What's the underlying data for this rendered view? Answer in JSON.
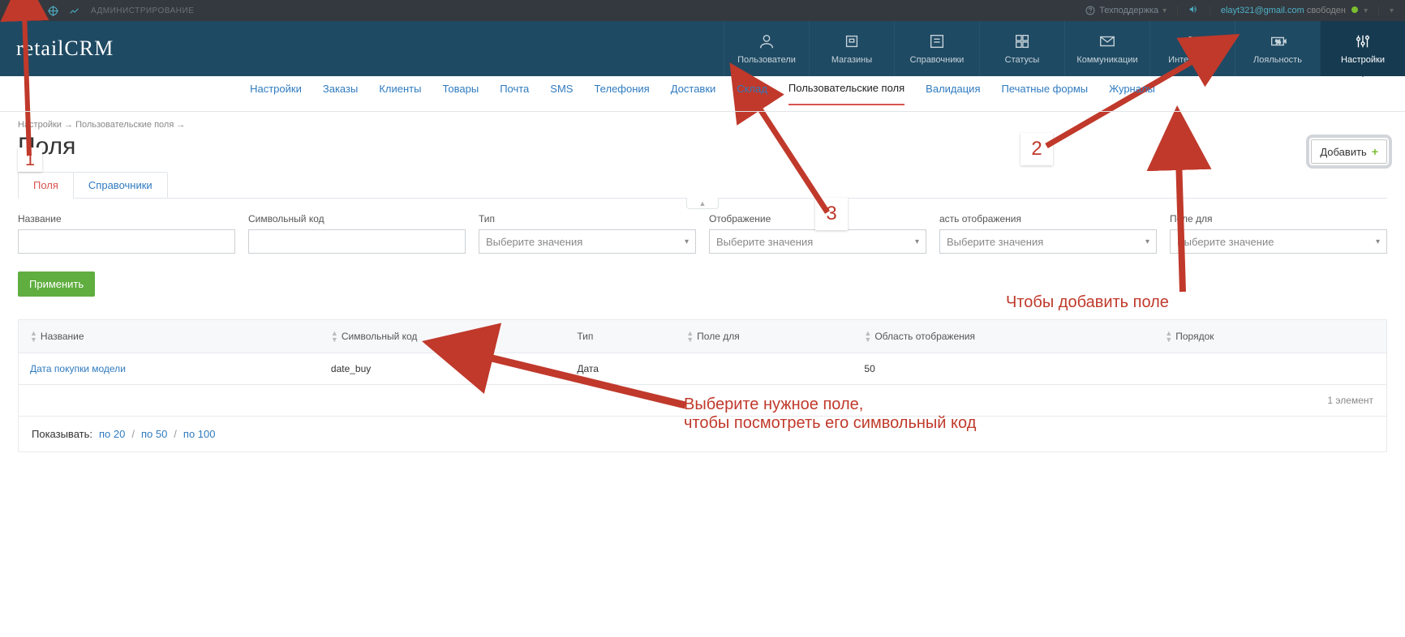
{
  "topbar": {
    "admin_label": "АДМИНИСТРИРОВАНИЕ",
    "support_label": "Техподдержка",
    "user_email": "elayt321@gmail.com",
    "user_status": "свободен"
  },
  "logo_text": "retailCRM",
  "main_nav": {
    "users": "Пользователи",
    "stores": "Магазины",
    "refs": "Справочники",
    "statuses": "Статусы",
    "comms": "Коммуникации",
    "integration": "Интеграция",
    "loyalty": "Лояльность",
    "settings": "Настройки"
  },
  "sub_nav": {
    "settings": "Настройки",
    "orders": "Заказы",
    "clients": "Клиенты",
    "products": "Товары",
    "mail": "Почта",
    "sms": "SMS",
    "telephony": "Телефония",
    "delivery": "Доставки",
    "stock": "Склад",
    "custom_fields": "Пользовательские поля",
    "validation": "Валидация",
    "print_forms": "Печатные формы",
    "journals": "Журналы"
  },
  "breadcrumb": {
    "l1": "Настройки",
    "l2": "Пользовательские поля"
  },
  "page_title": "Поля",
  "add_button": "Добавить",
  "tabs": {
    "fields": "Поля",
    "refs": "Справочники"
  },
  "filters": {
    "name_label": "Название",
    "code_label": "Символьный код",
    "type_label": "Тип",
    "type_placeholder": "Выберите значения",
    "display_label": "Отображение",
    "display_placeholder": "Выберите значения",
    "area_label": "асть отображения",
    "area_placeholder": "Выберите значения",
    "field_for_label": "Поле для",
    "field_for_placeholder": "Выберите значение"
  },
  "apply_button": "Применить",
  "table": {
    "headers": {
      "name": "Название",
      "code": "Символьный код",
      "type": "Тип",
      "field_for": "Поле для",
      "display_area": "Область отображения",
      "order": "Порядок"
    },
    "rows": [
      {
        "name": "Дата покупки модели",
        "code": "date_buy",
        "type": "Дата",
        "field_for": "",
        "display_area": "50",
        "order": ""
      }
    ],
    "footer_count": "1 элемент"
  },
  "pager": {
    "label": "Показывать:",
    "p20": "по 20",
    "p50": "по 50",
    "p100": "по 100"
  },
  "anno": {
    "n1": "1",
    "n2": "2",
    "n3": "3",
    "text_add": "Чтобы добавить поле",
    "text_select_l1": "Выберите нужное поле,",
    "text_select_l2": "чтобы посмотреть его символьный код"
  }
}
